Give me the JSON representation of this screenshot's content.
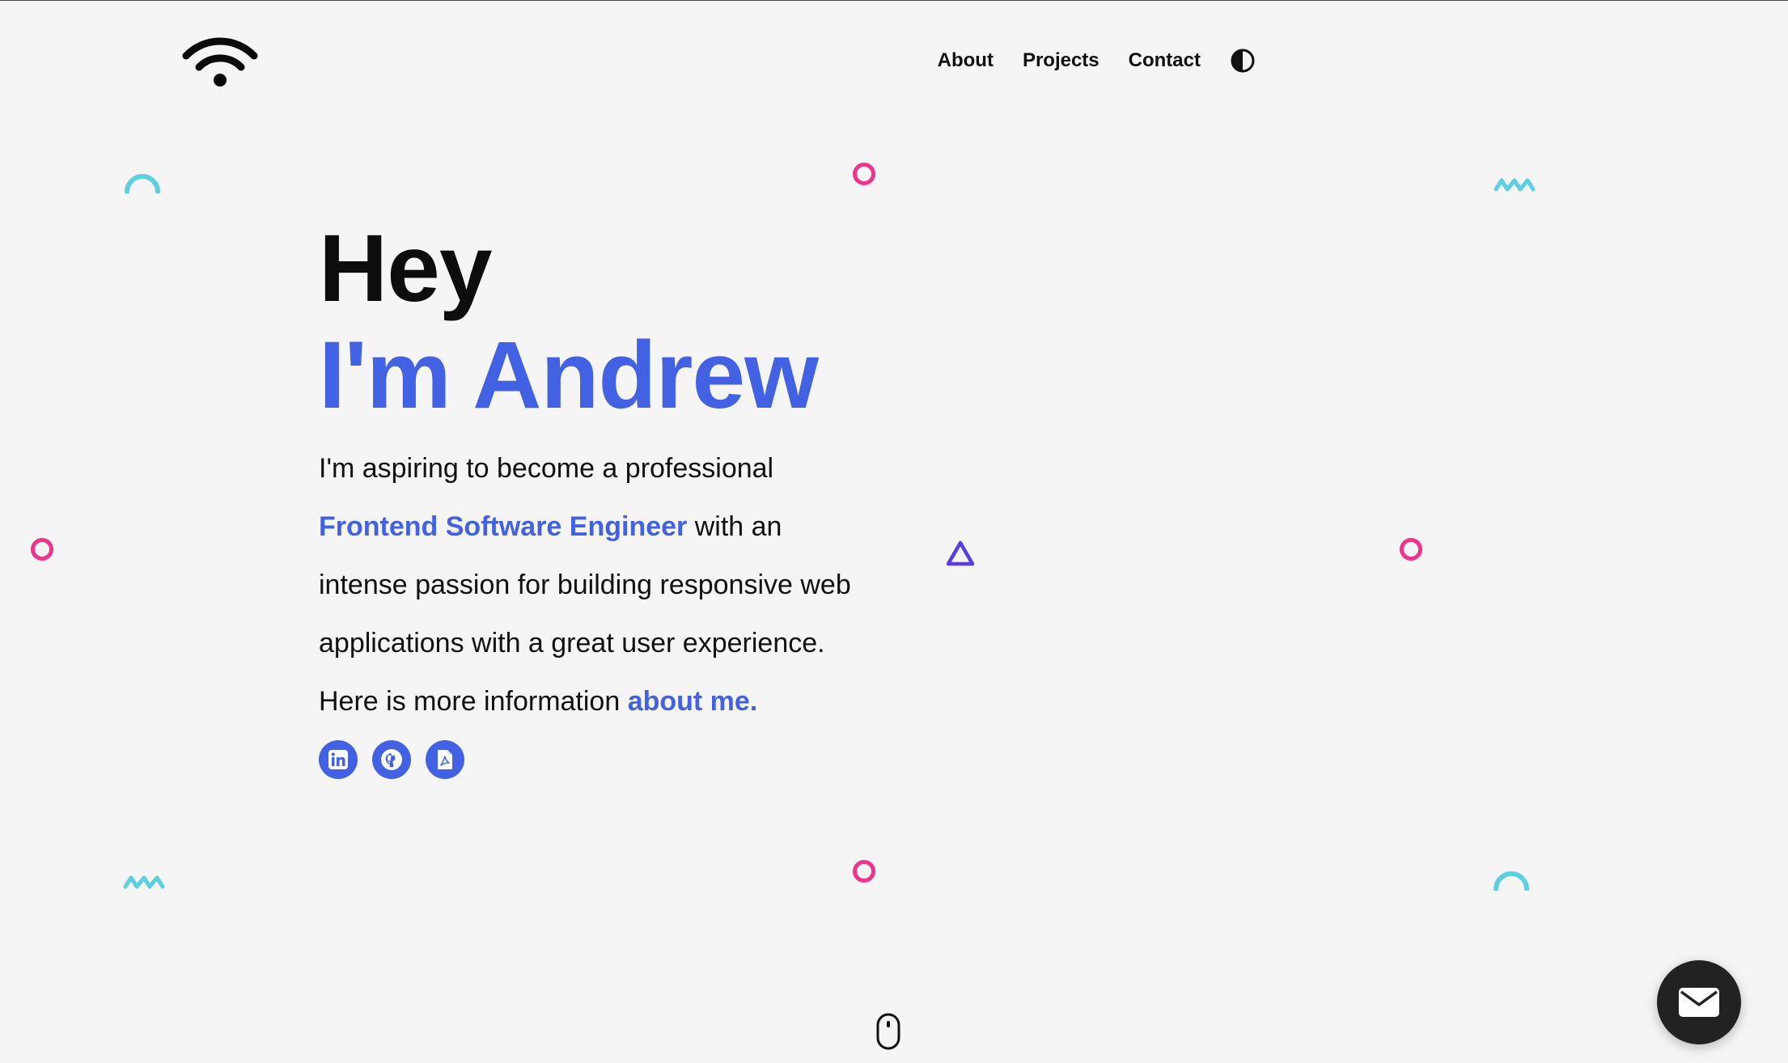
{
  "header": {
    "logo_icon": "wifi-icon",
    "nav": [
      {
        "label": "About"
      },
      {
        "label": "Projects"
      },
      {
        "label": "Contact"
      }
    ],
    "theme_toggle_icon": "half-circle-contrast-icon"
  },
  "hero": {
    "greeting": "Hey",
    "name": "I'm Andrew",
    "intro_before": "I'm aspiring to become a professional ",
    "intro_highlight": "Frontend Software Engineer",
    "intro_after": " with an intense passion for building responsive web applications with a great user experience.",
    "more_text": "Here is more information ",
    "more_link": "about me.",
    "socials": [
      {
        "icon": "linkedin-icon"
      },
      {
        "icon": "github-icon"
      },
      {
        "icon": "pdf-resume-icon"
      }
    ]
  },
  "decorations": {
    "shapes": [
      "arc-icon",
      "circle-icon",
      "zigzag-icon",
      "triangle-icon"
    ]
  },
  "scroll_indicator_icon": "mouse-scroll-icon",
  "contact_fab_icon": "envelope-icon",
  "colors": {
    "accent": "#4361e3",
    "pink": "#f0338d",
    "teal": "#5ccfe0",
    "violet": "#5a3be8",
    "background": "#f5f5f5",
    "fab": "#222222"
  }
}
